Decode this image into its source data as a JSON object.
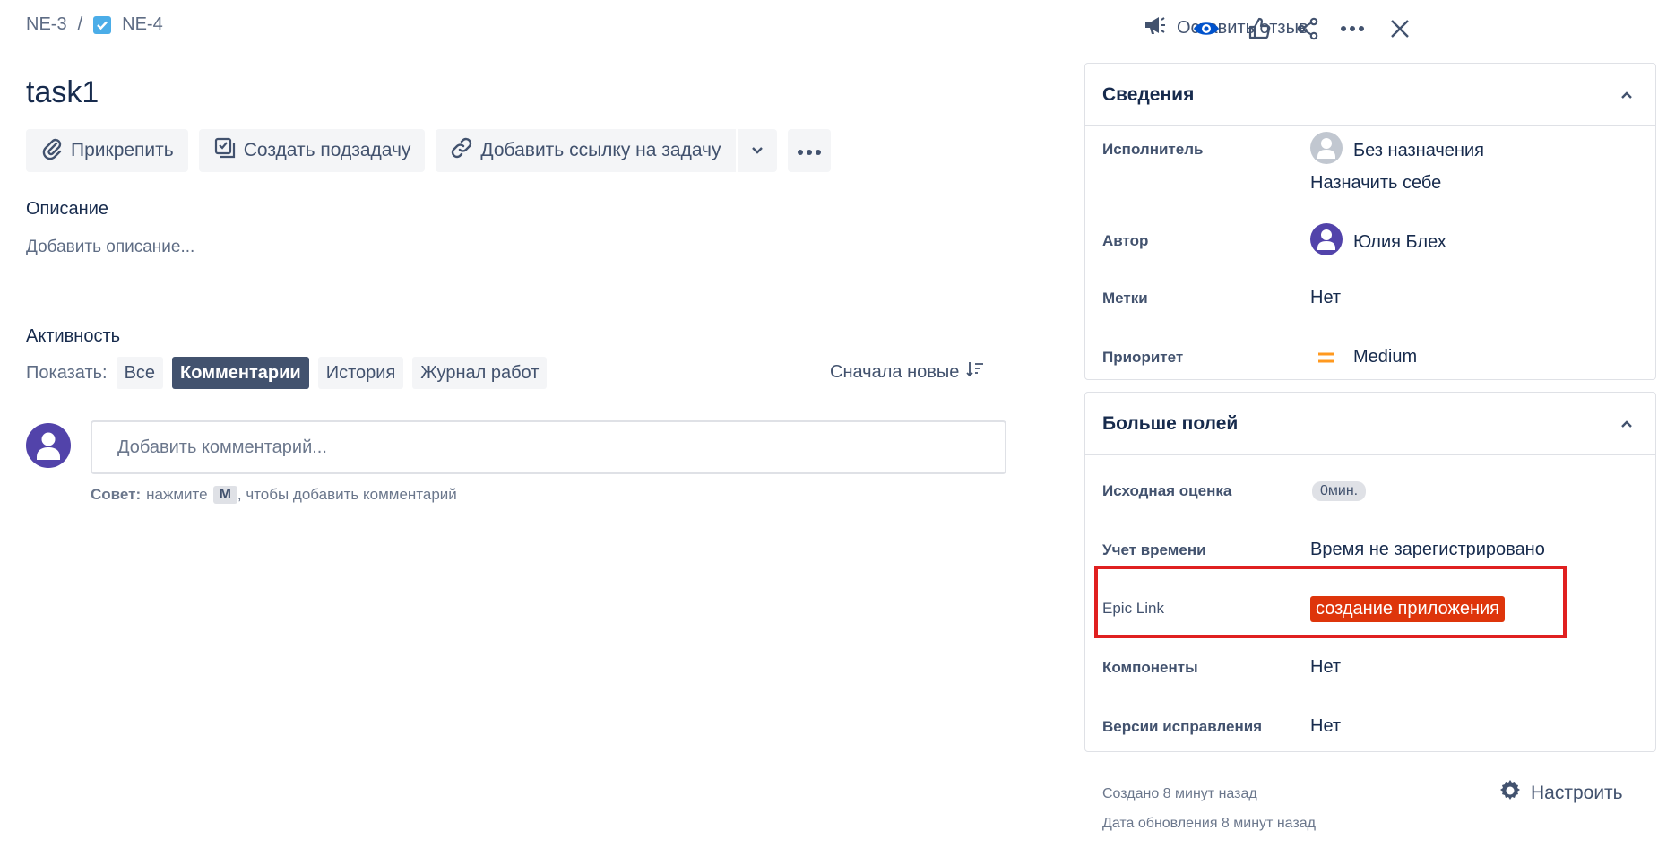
{
  "breadcrumb": {
    "parent": "NE-3",
    "separator": "/",
    "current": "NE-4"
  },
  "top_actions": {
    "feedback_label": "Оставить отзыв"
  },
  "issue": {
    "title": "task1"
  },
  "toolbar": {
    "attach_label": "Прикрепить",
    "subtask_label": "Создать подзадачу",
    "link_label": "Добавить ссылку на задачу"
  },
  "description": {
    "label": "Описание",
    "placeholder": "Добавить описание..."
  },
  "activity": {
    "label": "Активность",
    "show_label": "Показать:",
    "filters": [
      "Все",
      "Комментарии",
      "История",
      "Журнал работ"
    ],
    "active_filter": "Комментарии",
    "sort_label": "Сначала новые",
    "comment_placeholder": "Добавить комментарий...",
    "tip_bold": "Совет:",
    "tip_pre": "нажмите",
    "tip_key": "M",
    "tip_post": ", чтобы добавить комментарий"
  },
  "details": {
    "heading": "Сведения",
    "assignee_label": "Исполнитель",
    "assignee_value": "Без назначения",
    "assign_self": "Назначить себе",
    "reporter_label": "Автор",
    "reporter_value": "Юлия Блех",
    "labels_label": "Метки",
    "labels_value": "Нет",
    "priority_label": "Приоритет",
    "priority_value": "Medium"
  },
  "more_fields": {
    "heading": "Больше полей",
    "estimate_label": "Исходная оценка",
    "estimate_value": "0мин.",
    "time_label": "Учет времени",
    "time_value": "Время не зарегистрировано",
    "epic_label": "Epic Link",
    "epic_value": "создание приложения",
    "components_label": "Компоненты",
    "components_value": "Нет",
    "fix_versions_label": "Версии исправления",
    "fix_versions_value": "Нет"
  },
  "footer": {
    "created": "Создано 8 минут назад",
    "updated": "Дата обновления 8 минут назад",
    "configure_label": "Настроить"
  },
  "colors": {
    "accent": "#0052cc",
    "epic": "#de350b",
    "highlight": "#e02020",
    "priority_medium": "#ff991f"
  }
}
